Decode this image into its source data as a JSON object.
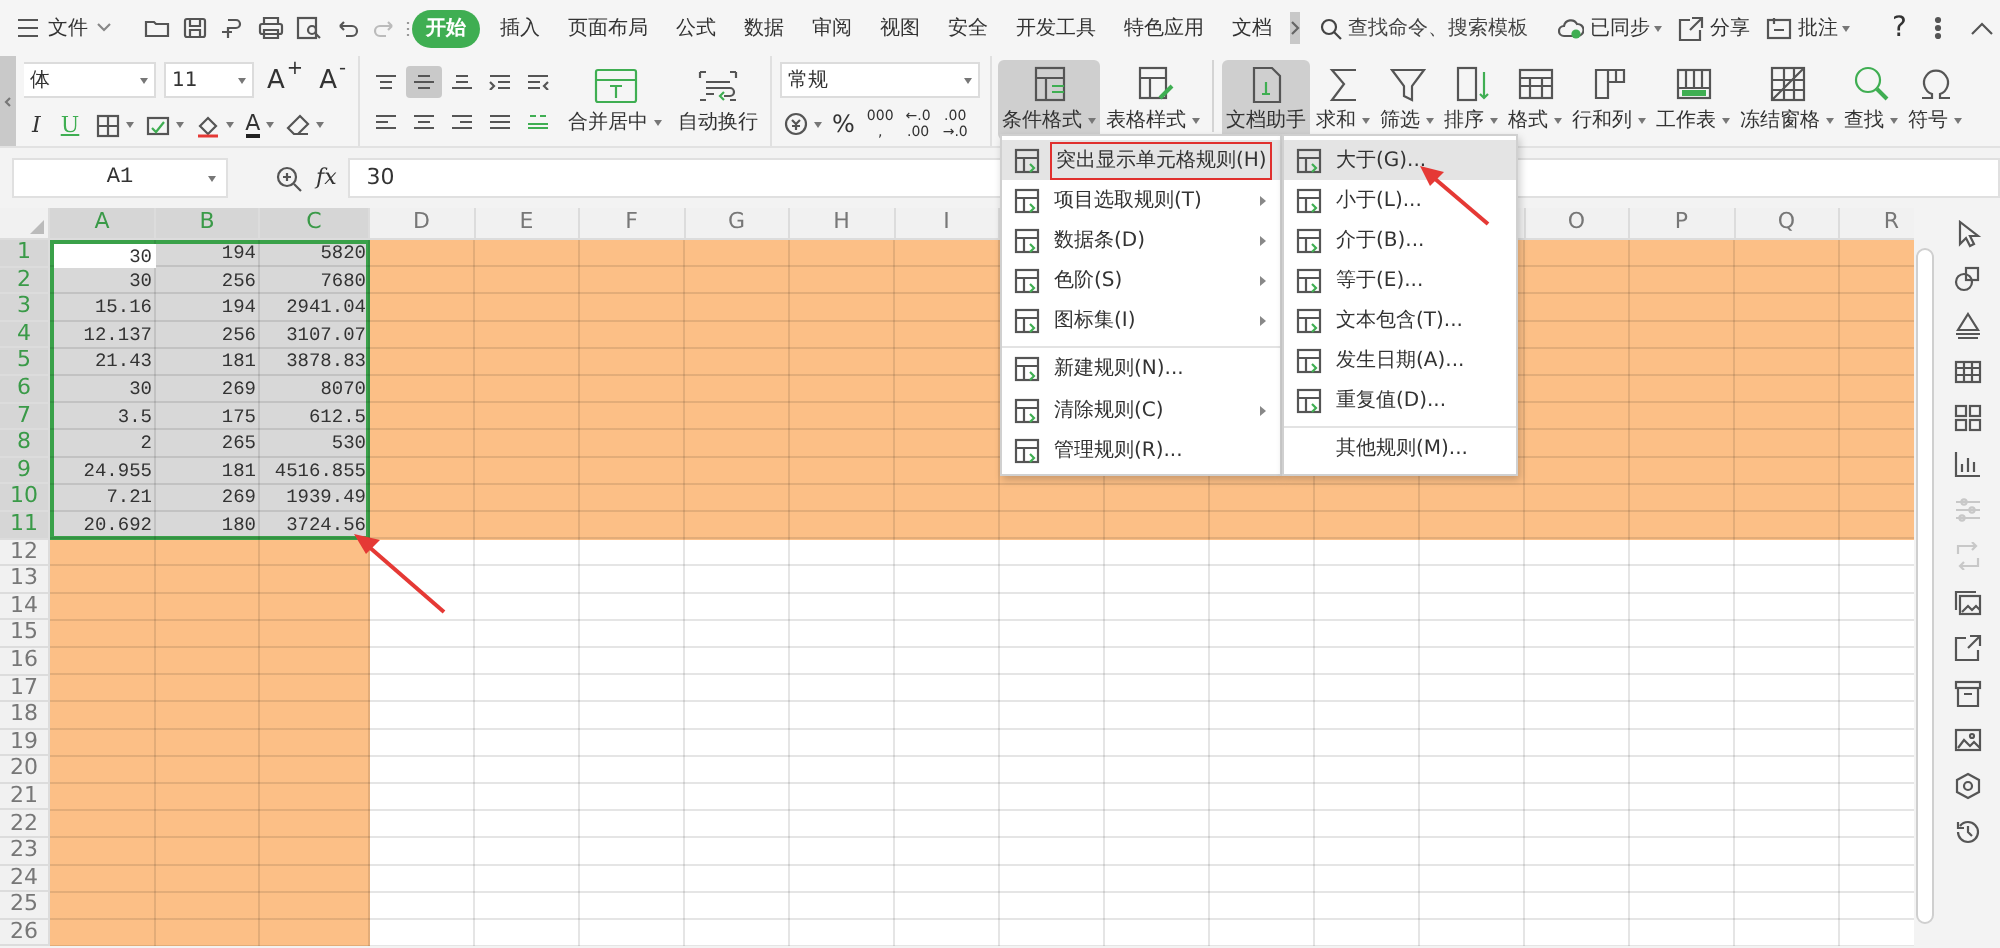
{
  "title_bar": {
    "file_menu": "文件",
    "tabs": [
      {
        "label": "开始",
        "selected": true
      },
      {
        "label": "插入",
        "selected": false
      },
      {
        "label": "页面布局",
        "selected": false
      },
      {
        "label": "公式",
        "selected": false
      },
      {
        "label": "数据",
        "selected": false
      },
      {
        "label": "审阅",
        "selected": false
      },
      {
        "label": "视图",
        "selected": false
      },
      {
        "label": "安全",
        "selected": false
      },
      {
        "label": "开发工具",
        "selected": false
      },
      {
        "label": "特色应用",
        "selected": false
      },
      {
        "label": "文档",
        "selected": false
      }
    ],
    "search": {
      "placeholder": "查找命令、搜索模板"
    },
    "actions": [
      {
        "label": "已同步",
        "dropdown": true
      },
      {
        "label": "分享",
        "dropdown": false
      },
      {
        "label": "批注",
        "dropdown": true
      }
    ],
    "help": "?"
  },
  "ribbon": {
    "font_name": "体",
    "font_size": "11",
    "font_buttons": [
      "A$^{+}$",
      "A$^{-}$"
    ],
    "style_buttons": [
      "I",
      "U"
    ],
    "font_color_button": "A",
    "alignment": [
      {
        "selected": false
      },
      {
        "selected": true
      },
      {
        "selected": false
      },
      {
        "selected": false
      },
      {
        "selected": false
      },
      {
        "selected": false
      },
      {
        "selected": false
      },
      {
        "selected": false
      },
      {
        "selected": false
      },
      {
        "selected": false
      }
    ],
    "align_tools": [
      {
        "label": "合并居中",
        "dropdown": true
      },
      {
        "label": "自动换行",
        "dropdown": false
      }
    ],
    "number_format": "常规",
    "number_buttons": [
      {
        "lines": [
          "%"
        ]
      },
      {
        "lines": [
          "000",
          ","
        ]
      },
      {
        "lines": [
          "←.0",
          ".00"
        ]
      },
      {
        "lines": [
          ".00",
          "→.0"
        ]
      }
    ],
    "tools": [
      {
        "label": "条件格式",
        "active": true,
        "dropdown": true
      },
      {
        "label": "表格样式",
        "active": false,
        "dropdown": true
      },
      {
        "label": "文档助手",
        "active": true,
        "dropdown": false
      },
      {
        "label": "求和",
        "active": false,
        "dropdown": true
      },
      {
        "label": "筛选",
        "active": false,
        "dropdown": true
      },
      {
        "label": "排序",
        "active": false,
        "dropdown": true
      },
      {
        "label": "格式",
        "active": false,
        "dropdown": true
      },
      {
        "label": "行和列",
        "active": false,
        "dropdown": true
      },
      {
        "label": "工作表",
        "active": false,
        "dropdown": true
      },
      {
        "label": "冻结窗格",
        "active": false,
        "dropdown": true
      },
      {
        "label": "查找",
        "active": false,
        "dropdown": true
      },
      {
        "label": "符号",
        "active": false,
        "dropdown": true
      }
    ]
  },
  "formula_bar": {
    "name_box": "A1",
    "fx": "fx",
    "value": "30"
  },
  "sheet": {
    "columns": [
      {
        "kind": "label",
        "label": "A",
        "selected": true
      },
      {
        "kind": "label",
        "label": "B",
        "selected": true
      },
      {
        "kind": "label",
        "label": "C",
        "selected": true
      },
      {
        "kind": "label",
        "label": "D",
        "selected": false
      },
      {
        "kind": "label",
        "label": "E",
        "selected": false
      },
      {
        "kind": "label",
        "label": "F",
        "selected": false
      },
      {
        "kind": "label",
        "label": "G",
        "selected": false
      },
      {
        "kind": "label",
        "label": "H",
        "selected": false
      },
      {
        "kind": "label",
        "label": "I",
        "selected": false
      },
      {
        "kind": "covered"
      },
      {
        "kind": "covered"
      },
      {
        "kind": "covered"
      },
      {
        "kind": "covered"
      },
      {
        "kind": "covered"
      },
      {
        "kind": "label",
        "label": "O",
        "selected": false
      },
      {
        "kind": "label",
        "label": "P",
        "selected": false
      },
      {
        "kind": "label",
        "label": "Q",
        "selected": false
      },
      {
        "kind": "label",
        "label": "R",
        "selected": false
      }
    ],
    "rows": [
      {
        "label": "1",
        "selected": true,
        "kind": "full",
        "cells": [
          "30",
          "194",
          "5820"
        ]
      },
      {
        "label": "2",
        "selected": true,
        "kind": "full",
        "cells": [
          "30",
          "256",
          "7680"
        ]
      },
      {
        "label": "3",
        "selected": true,
        "kind": "full",
        "cells": [
          "15.16",
          "194",
          "2941.04"
        ]
      },
      {
        "label": "4",
        "selected": true,
        "kind": "full",
        "cells": [
          "12.137",
          "256",
          "3107.07"
        ]
      },
      {
        "label": "5",
        "selected": true,
        "kind": "full",
        "cells": [
          "21.43",
          "181",
          "3878.83"
        ]
      },
      {
        "label": "6",
        "selected": true,
        "kind": "full",
        "cells": [
          "30",
          "269",
          "8070"
        ]
      },
      {
        "label": "7",
        "selected": true,
        "kind": "full",
        "cells": [
          "3.5",
          "175",
          "612.5"
        ]
      },
      {
        "label": "8",
        "selected": true,
        "kind": "full",
        "cells": [
          "2",
          "265",
          "530"
        ]
      },
      {
        "label": "9",
        "selected": true,
        "kind": "full",
        "cells": [
          "24.955",
          "181",
          "4516.855"
        ]
      },
      {
        "label": "10",
        "selected": true,
        "kind": "full",
        "cells": [
          "7.21",
          "269",
          "1939.49"
        ]
      },
      {
        "label": "11",
        "selected": true,
        "kind": "full",
        "cells": [
          "20.692",
          "180",
          "3724.56"
        ]
      },
      {
        "label": "12",
        "selected": false,
        "kind": "left"
      },
      {
        "label": "13",
        "selected": false,
        "kind": "left"
      },
      {
        "label": "14",
        "selected": false,
        "kind": "left"
      },
      {
        "label": "15",
        "selected": false,
        "kind": "left"
      },
      {
        "label": "16",
        "selected": false,
        "kind": "left"
      },
      {
        "label": "17",
        "selected": false,
        "kind": "left"
      },
      {
        "label": "18",
        "selected": false,
        "kind": "left"
      },
      {
        "label": "19",
        "selected": false,
        "kind": "left"
      },
      {
        "label": "20",
        "selected": false,
        "kind": "left"
      },
      {
        "label": "21",
        "selected": false,
        "kind": "left"
      },
      {
        "label": "22",
        "selected": false,
        "kind": "left"
      },
      {
        "label": "23",
        "selected": false,
        "kind": "left"
      },
      {
        "label": "24",
        "selected": false,
        "kind": "left"
      },
      {
        "label": "25",
        "selected": false,
        "kind": "left"
      },
      {
        "label": "26",
        "selected": false,
        "kind": "left"
      }
    ]
  },
  "menu": {
    "items": [
      {
        "label": "突出显示单元格规则(H)",
        "submenu": true,
        "selected": true,
        "outlined": true,
        "separator_before": false
      },
      {
        "label": "项目选取规则(T)",
        "submenu": true,
        "selected": false,
        "outlined": false,
        "separator_before": false
      },
      {
        "label": "数据条(D)",
        "submenu": true,
        "selected": false,
        "outlined": false,
        "separator_before": false
      },
      {
        "label": "色阶(S)",
        "submenu": true,
        "selected": false,
        "outlined": false,
        "separator_before": false
      },
      {
        "label": "图标集(I)",
        "submenu": true,
        "selected": false,
        "outlined": false,
        "separator_before": false
      },
      {
        "label": "新建规则(N)...",
        "submenu": false,
        "selected": false,
        "outlined": false,
        "separator_before": true
      },
      {
        "label": "清除规则(C)",
        "submenu": true,
        "selected": false,
        "outlined": false,
        "separator_before": false
      },
      {
        "label": "管理规则(R)...",
        "submenu": false,
        "selected": false,
        "outlined": false,
        "separator_before": false
      }
    ],
    "submenu": [
      {
        "label": "大于(G)...",
        "kind": "icon",
        "selected": true,
        "separator_before": false
      },
      {
        "label": "小于(L)...",
        "kind": "icon",
        "selected": false,
        "separator_before": false
      },
      {
        "label": "介于(B)...",
        "kind": "icon",
        "selected": false,
        "separator_before": false
      },
      {
        "label": "等于(E)...",
        "kind": "icon",
        "selected": false,
        "separator_before": false
      },
      {
        "label": "文本包含(T)...",
        "kind": "icon",
        "selected": false,
        "separator_before": false
      },
      {
        "label": "发生日期(A)...",
        "kind": "icon",
        "selected": false,
        "separator_before": false
      },
      {
        "label": "重复值(D)...",
        "kind": "icon",
        "selected": false,
        "separator_before": false
      },
      {
        "label": "其他规则(M)...",
        "kind": "plain",
        "selected": false,
        "separator_before": true
      }
    ]
  }
}
